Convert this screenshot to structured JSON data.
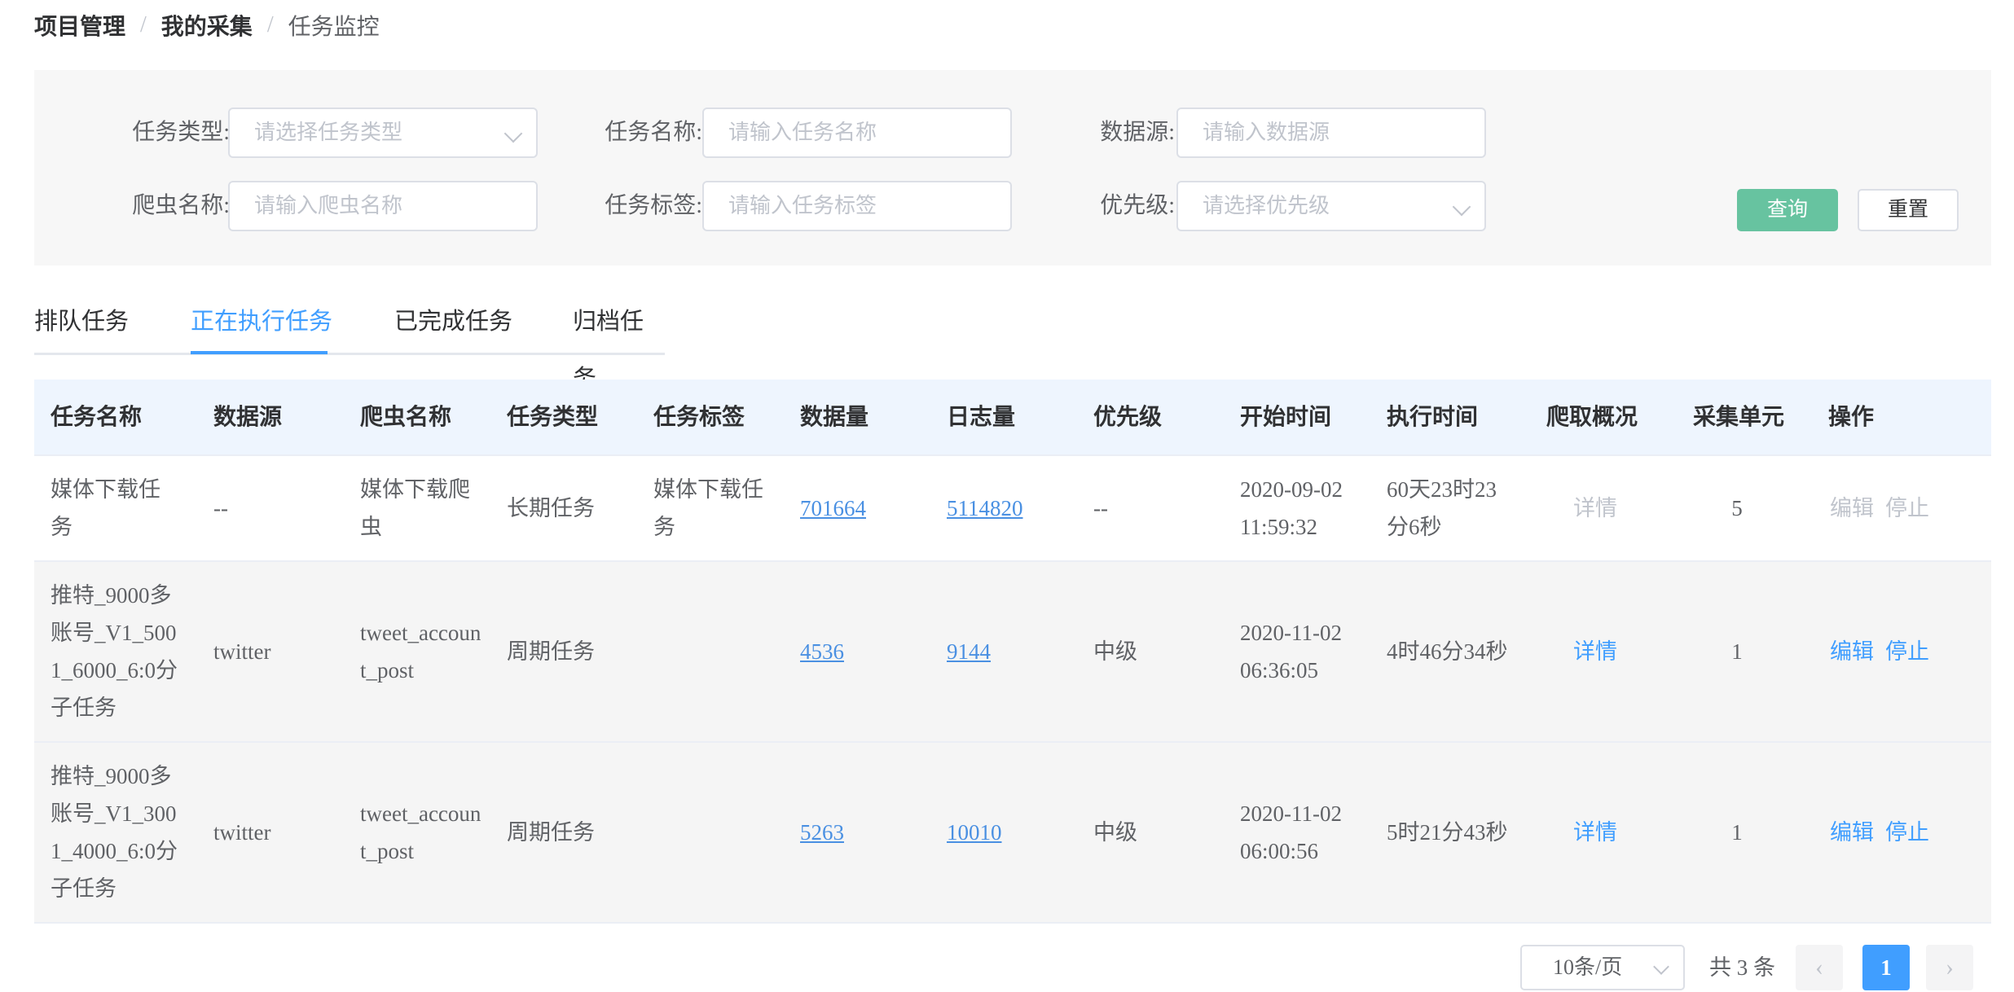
{
  "breadcrumb": [
    {
      "label": "项目管理"
    },
    {
      "label": "我的采集"
    },
    {
      "label": "任务监控"
    }
  ],
  "breadcrumb_separator": "/",
  "filters": {
    "task_type": {
      "label": "任务类型:",
      "placeholder": "请选择任务类型"
    },
    "task_name": {
      "label": "任务名称:",
      "placeholder": "请输入任务名称"
    },
    "datasource": {
      "label": "数据源:",
      "placeholder": "请输入数据源"
    },
    "crawler_name": {
      "label": "爬虫名称:",
      "placeholder": "请输入爬虫名称"
    },
    "task_tag": {
      "label": "任务标签:",
      "placeholder": "请输入任务标签"
    },
    "priority": {
      "label": "优先级:",
      "placeholder": "请选择优先级"
    },
    "query_button": "查询",
    "reset_button": "重置"
  },
  "tabs": [
    {
      "label": "排队任务",
      "active": false
    },
    {
      "label": "正在执行任务",
      "active": true
    },
    {
      "label": "已完成任务",
      "active": false
    },
    {
      "label": "归档任务",
      "active": false
    }
  ],
  "table": {
    "headers": [
      "任务名称",
      "数据源",
      "爬虫名称",
      "任务类型",
      "任务标签",
      "数据量",
      "日志量",
      "优先级",
      "开始时间",
      "执行时间",
      "爬取概况",
      "采集单元",
      "操作"
    ],
    "rows": [
      {
        "task_name": "媒体下载任务",
        "datasource": "--",
        "crawler": "媒体下载爬虫",
        "type": "长期任务",
        "tag": "媒体下载任务",
        "data_count": "701664",
        "log_count": "5114820",
        "priority": "--",
        "start_time": "2020-09-02 11:59:32",
        "exec_time": "60天23时23分6秒",
        "overview": "详情",
        "units": "5",
        "edit": "编辑",
        "stop": "停止",
        "actions_enabled": false
      },
      {
        "task_name": "推特_9000多账号_V1_5001_6000_6:0分子任务",
        "datasource": "twitter",
        "crawler": "tweet_account_post",
        "type": "周期任务",
        "tag": "",
        "data_count": "4536",
        "log_count": "9144",
        "priority": "中级",
        "start_time": "2020-11-02 06:36:05",
        "exec_time": "4时46分34秒",
        "overview": "详情",
        "units": "1",
        "edit": "编辑",
        "stop": "停止",
        "actions_enabled": true
      },
      {
        "task_name": "推特_9000多账号_V1_3001_4000_6:0分子任务",
        "datasource": "twitter",
        "crawler": "tweet_account_post",
        "type": "周期任务",
        "tag": "",
        "data_count": "5263",
        "log_count": "10010",
        "priority": "中级",
        "start_time": "2020-11-02 06:00:56",
        "exec_time": "5时21分43秒",
        "overview": "详情",
        "units": "1",
        "edit": "编辑",
        "stop": "停止",
        "actions_enabled": true
      }
    ]
  },
  "pagination": {
    "page_size": "10条/页",
    "total": "共 3 条",
    "current_page": "1",
    "prev_icon": "chevron-left-icon",
    "next_icon": "chevron-right-icon"
  },
  "colors": {
    "primary": "#409eff",
    "query_button": "#67c3a0",
    "header_bg": "#eef5fe"
  }
}
